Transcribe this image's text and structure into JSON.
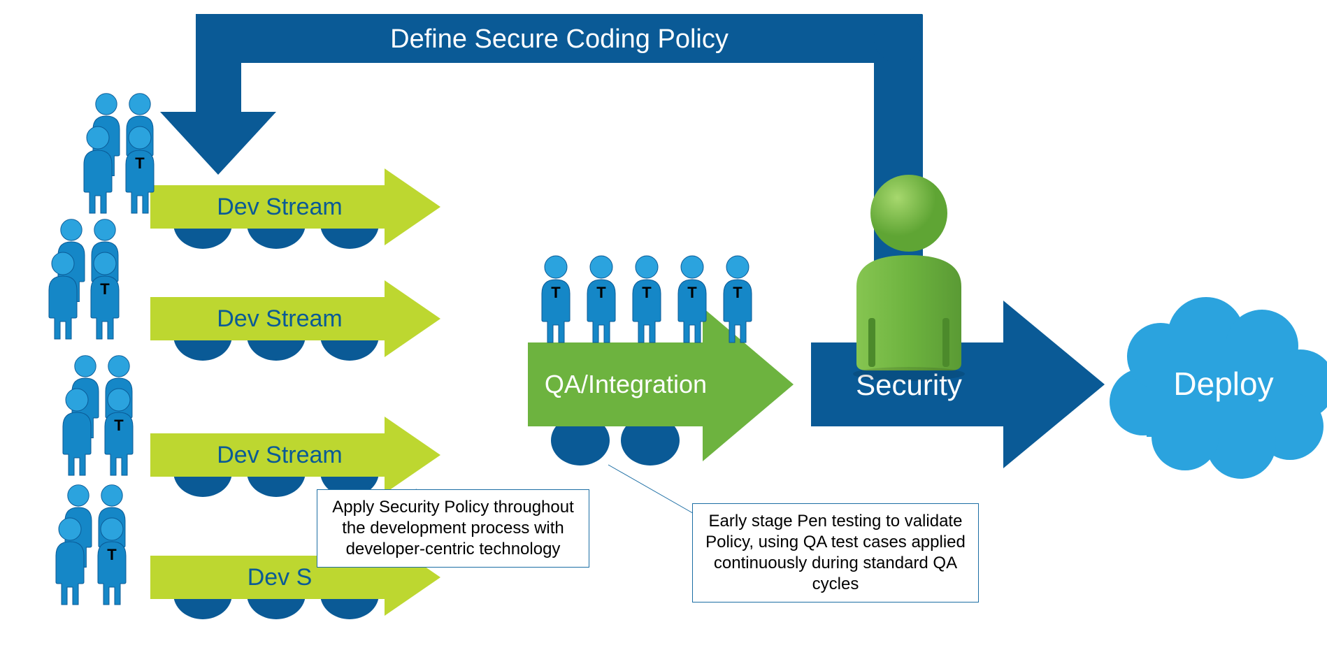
{
  "topBanner": {
    "label": "Define Secure Coding Policy"
  },
  "devStreams": {
    "label1": "Dev Stream",
    "label2": "Dev Stream",
    "label3": "Dev Stream",
    "label4": "Dev S"
  },
  "qaArrow": {
    "label": "QA/Integration"
  },
  "securityArrow": {
    "label": "Security"
  },
  "deployCloud": {
    "label": "Deploy"
  },
  "callouts": {
    "dev": "Apply Security Policy throughout the development process with developer-centric technology",
    "qa": "Early stage Pen testing to validate Policy, using QA test cases applied continuously during standard QA cycles"
  },
  "colors": {
    "darkBlue": "#0A5A96",
    "midBlue": "#1587C7",
    "lightBlue": "#2BA3DE",
    "yellowGreen": "#BDD730",
    "green": "#6DB33F",
    "greenHead": "#74B843"
  }
}
